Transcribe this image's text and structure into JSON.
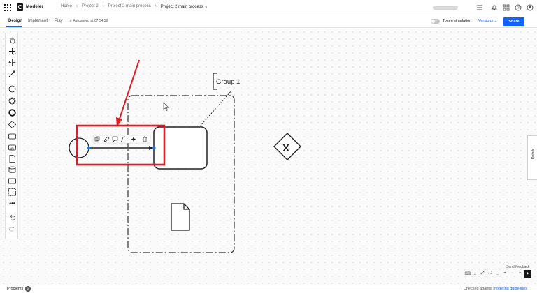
{
  "app": {
    "name": "Modeler"
  },
  "breadcrumb": {
    "items": [
      "Home",
      "Project 2",
      "Project 2 main process"
    ],
    "current": "Project 2 main process"
  },
  "tabs": [
    {
      "label": "Design"
    },
    {
      "label": "Implement"
    },
    {
      "label": "Play"
    }
  ],
  "autosave": {
    "text": "Autosaved at 07:54:39"
  },
  "token_simulation": {
    "label": "Token simulation",
    "enabled": false
  },
  "versions": {
    "label": "Versions"
  },
  "share": {
    "label": "Share"
  },
  "palette": {
    "icons": [
      "hand-tool-icon",
      "lasso-tool-icon",
      "space-tool-icon",
      "connect-tool-icon",
      "start-event-icon",
      "intermediate-event-icon",
      "end-event-icon",
      "gateway-icon",
      "task-icon",
      "subprocess-icon",
      "data-object-icon",
      "data-store-icon",
      "pool-icon",
      "group-icon",
      "more-icon",
      "undo-icon",
      "redo-icon"
    ]
  },
  "diagram": {
    "group_label": "Group 1",
    "gateway_symbol": "X",
    "context_pad": [
      "copy-icon",
      "edit-icon",
      "comment-icon",
      "connector-icon",
      "ai-sparkle-icon",
      "delete-icon"
    ]
  },
  "details_panel": {
    "label": "Details"
  },
  "send_feedback": {
    "label": "Send feedback"
  },
  "status": {
    "problems_label": "Problems",
    "problems_count": "0",
    "checked_prefix": "Checked against",
    "checked_link": "modeling guidelines"
  },
  "colors": {
    "accent": "#0f62fe",
    "highlight": "#e01b24",
    "selection": "#1a73e8"
  }
}
